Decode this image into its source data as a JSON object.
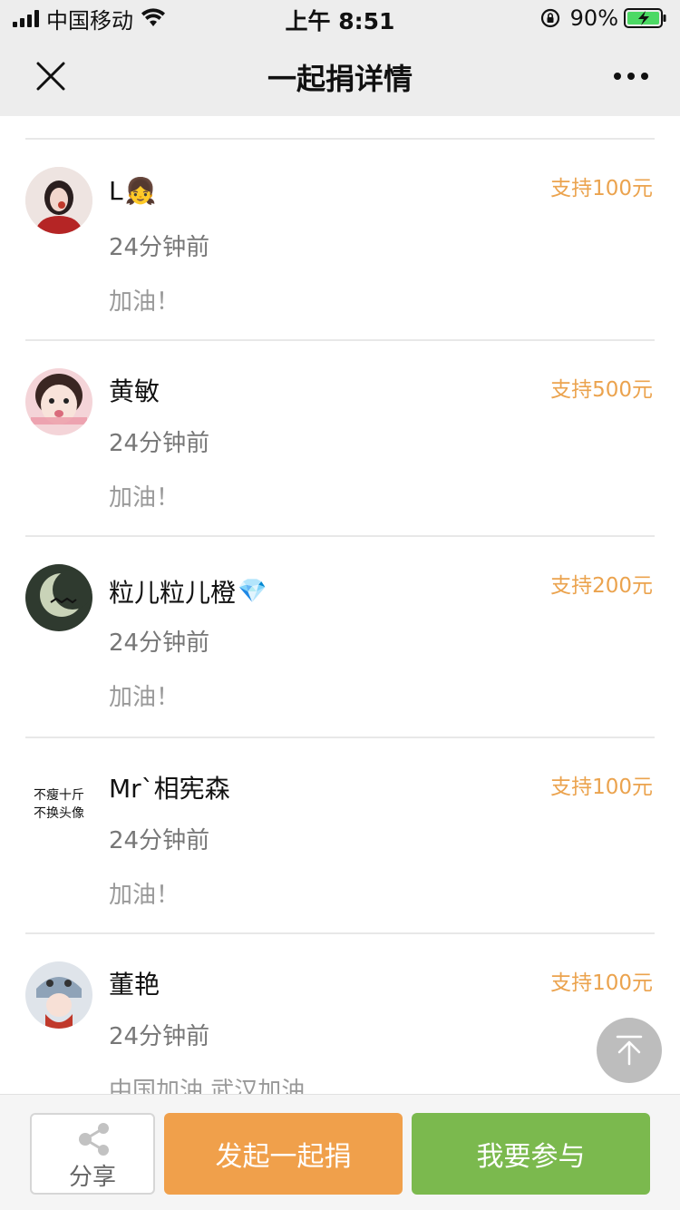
{
  "status_bar": {
    "carrier": "中国移动",
    "time": "上午 8:51",
    "battery": "90%"
  },
  "nav": {
    "title": "一起捐详情"
  },
  "donations": [
    {
      "name": "L",
      "emoji": "👧",
      "amount": "支持100元",
      "time": "24分钟前",
      "message": "加油！",
      "avatar_color": "#c94b4b"
    },
    {
      "name": "黄敏",
      "emoji": "",
      "amount": "支持500元",
      "time": "24分钟前",
      "message": "加油！",
      "avatar_color": "#f2b8c0"
    },
    {
      "name": "粒儿粒儿橙",
      "emoji": "💎",
      "amount": "支持200元",
      "time": "24分钟前",
      "message": "加油！",
      "avatar_color": "#3f4a3e"
    },
    {
      "name": "Mr`相宪森",
      "emoji": "",
      "amount": "支持100元",
      "time": "24分钟前",
      "message": "加油！",
      "avatar_text_1": "不瘦十斤",
      "avatar_text_2": "不换头像"
    },
    {
      "name": "董艳",
      "emoji": "",
      "amount": "支持100元",
      "time": "24分钟前",
      "message": "中国加油 武汉加油",
      "avatar_color": "#8fa3b8"
    }
  ],
  "bottom_bar": {
    "share_label": "分享",
    "start_label": "发起一起捐",
    "join_label": "我要参与"
  },
  "colors": {
    "amount": "#eba34e",
    "start_button": "#f0a04b",
    "join_button": "#7bb94e",
    "header_bg": "#ededed"
  },
  "icons": [
    "signal-icon",
    "wifi-icon",
    "orientation-lock-icon",
    "battery-icon",
    "close-icon",
    "more-icon",
    "back-to-top-icon",
    "share-icon"
  ]
}
